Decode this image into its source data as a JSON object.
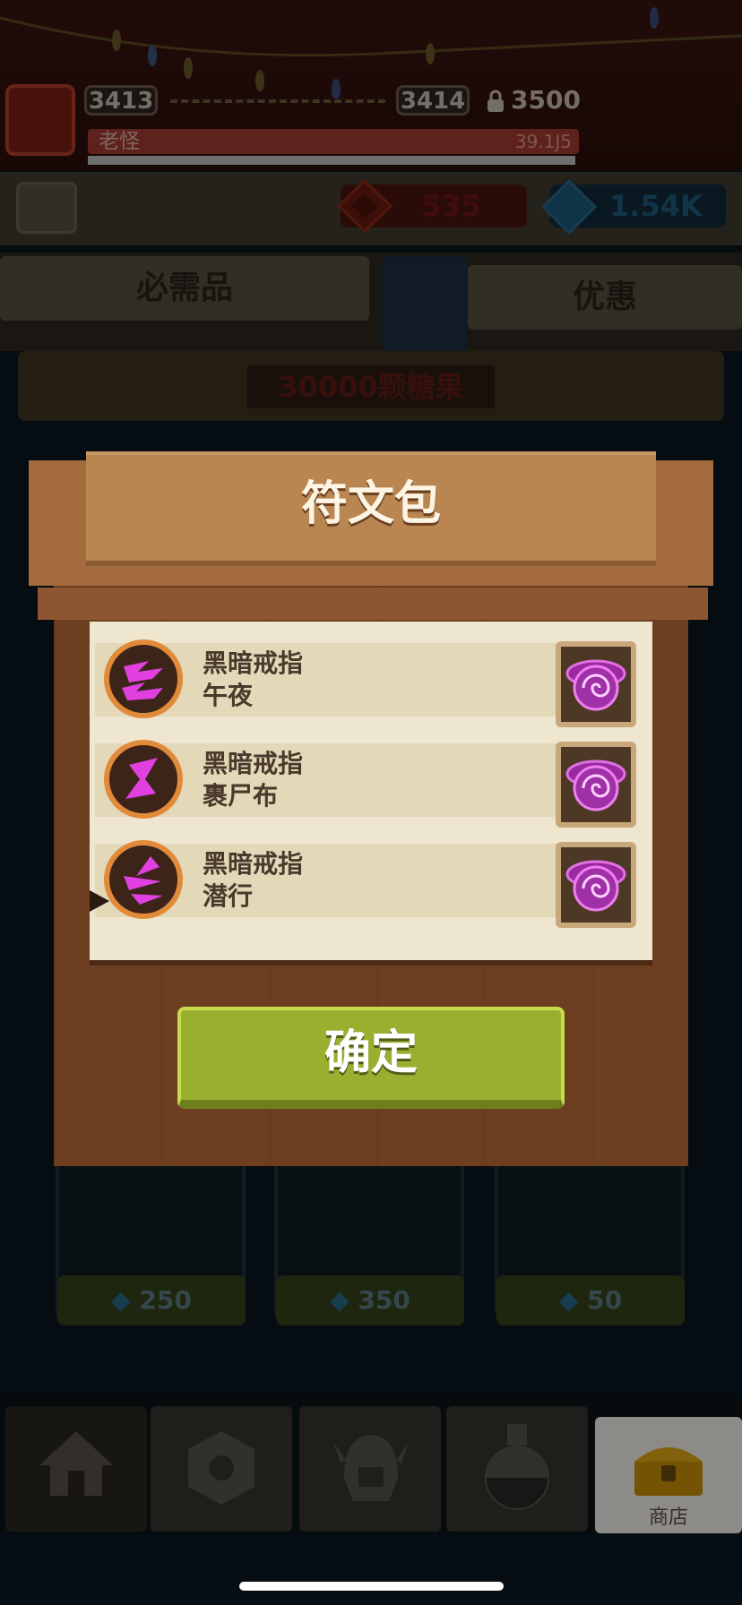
{
  "hud": {
    "current_level": "3413",
    "next_level": "3414",
    "lock_level": "3500",
    "boss_name": "老怪",
    "boss_hp": "39.1J5"
  },
  "resources": {
    "red_gems": "535",
    "blue_gems": "1.54K"
  },
  "tabs": {
    "left": "必需品",
    "right": "优惠"
  },
  "promo": {
    "label": "30000颗糖果"
  },
  "shop_prices": [
    "250",
    "350",
    "50"
  ],
  "nav": {
    "shop_label": "商店"
  },
  "modal": {
    "title": "符文包",
    "confirm_label": "确定",
    "items": [
      {
        "name": "黑暗戒指",
        "rune": "午夜",
        "rune_icon": "wave-rune-icon"
      },
      {
        "name": "黑暗戒指",
        "rune": "裹尸布",
        "rune_icon": "s-rune-icon"
      },
      {
        "name": "黑暗戒指",
        "rune": "潜行",
        "rune_icon": "chevron-rune-icon"
      }
    ]
  },
  "colors": {
    "accent_green": "#9aae30",
    "rune_magenta": "#e040e0",
    "wood": "#6e3e20",
    "paper": "#efe6cf"
  }
}
